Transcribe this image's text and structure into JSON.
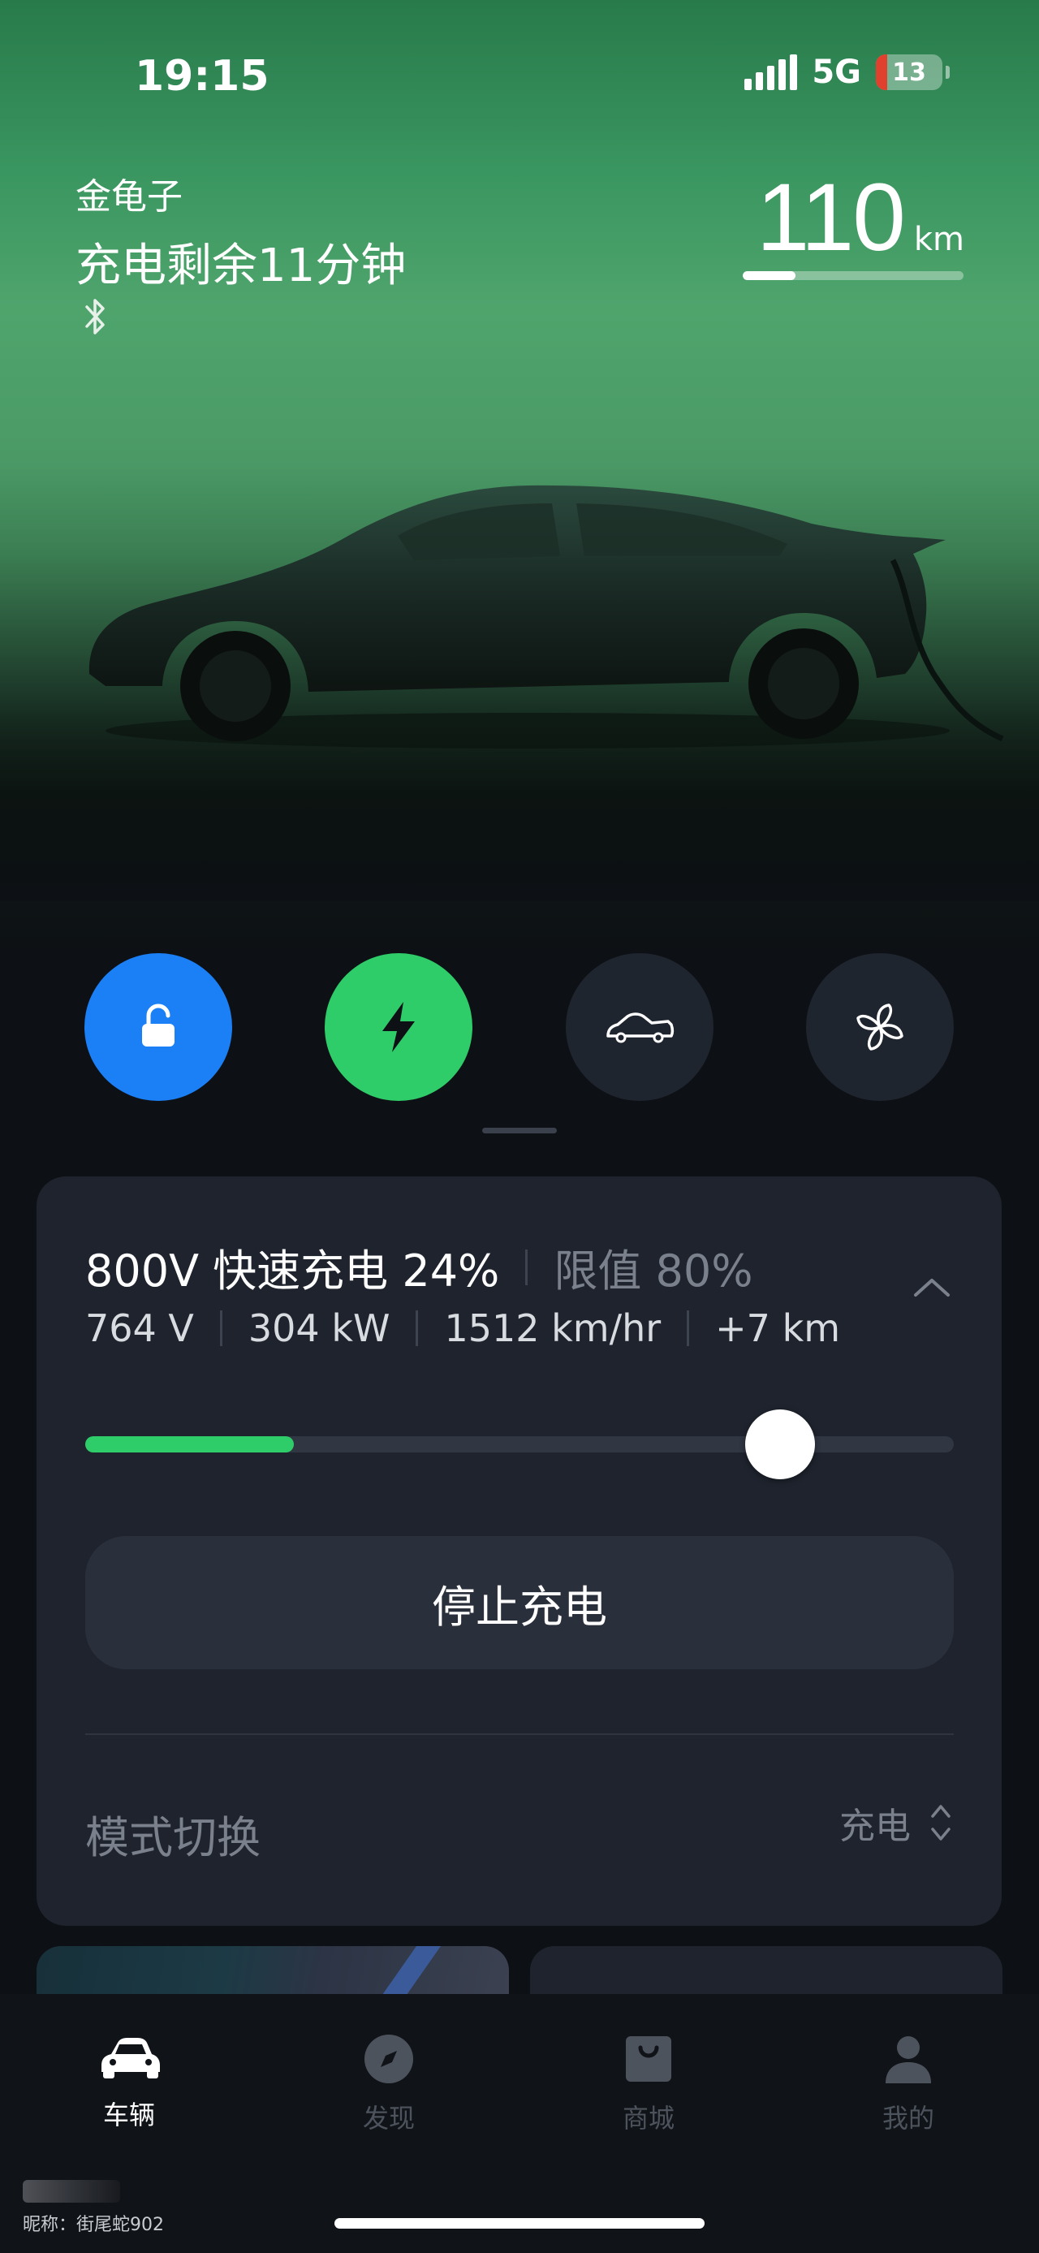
{
  "status_bar": {
    "time": "19:15",
    "network": "5G",
    "battery": "13"
  },
  "vehicle": {
    "name": "金龟子",
    "charge_status": "充电剩余11分钟",
    "range_value": "110",
    "range_unit": "km",
    "range_fraction": 0.24
  },
  "quick_actions": [
    {
      "name": "unlock",
      "icon": "unlock-icon",
      "color": "#1b7ff5"
    },
    {
      "name": "charge",
      "icon": "lightning-icon",
      "color": "#2fcd6a"
    },
    {
      "name": "trunk",
      "icon": "car-trunk-icon",
      "color": "#1f252f"
    },
    {
      "name": "climate",
      "icon": "fan-icon",
      "color": "#1f252f"
    }
  ],
  "charging": {
    "title": "800V 快速充电 24%",
    "limit": "限值 80%",
    "voltage": "764 V",
    "power": "304 kW",
    "rate": "1512 km/hr",
    "added": "+7 km",
    "current_percent": 24,
    "limit_percent": 80,
    "stop_button": "停止充电",
    "mode_label": "模式切换",
    "mode_value": "充电"
  },
  "tabbar": [
    {
      "label": "车辆",
      "icon": "car-icon",
      "active": true
    },
    {
      "label": "发现",
      "icon": "compass-icon",
      "active": false
    },
    {
      "label": "商城",
      "icon": "shopping-bag-icon",
      "active": false
    },
    {
      "label": "我的",
      "icon": "person-icon",
      "active": false
    }
  ],
  "watermark": "昵称：街尾蛇902"
}
